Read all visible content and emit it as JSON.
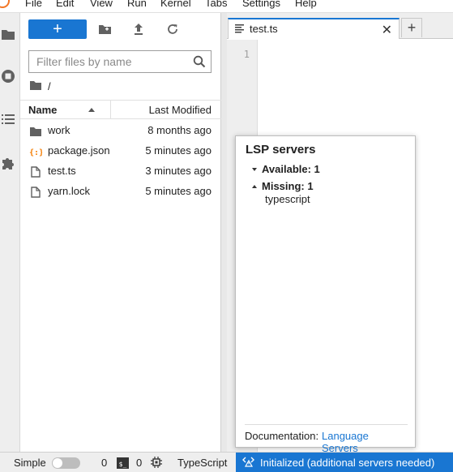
{
  "menubar": {
    "items": [
      "File",
      "Edit",
      "View",
      "Run",
      "Kernel",
      "Tabs",
      "Settings",
      "Help"
    ]
  },
  "filebrowser": {
    "new_label": "+",
    "filter_placeholder": "Filter files by name",
    "breadcrumb": "/",
    "header": {
      "name": "Name",
      "modified": "Last Modified"
    },
    "files": [
      {
        "name": "work",
        "modified": "8 months ago",
        "icon": "folder-icon"
      },
      {
        "name": "package.json",
        "modified": "5 minutes ago",
        "icon": "json-file-icon"
      },
      {
        "name": "test.ts",
        "modified": "3 minutes ago",
        "icon": "file-icon"
      },
      {
        "name": "yarn.lock",
        "modified": "5 minutes ago",
        "icon": "file-icon"
      }
    ]
  },
  "editor": {
    "tab_label": "test.ts",
    "close_glyph": "✕",
    "add_glyph": "+",
    "line_number": "1"
  },
  "lsp_popup": {
    "title": "LSP servers",
    "available_label": "Available: 1",
    "missing_label": "Missing: 1",
    "missing_servers": [
      "typescript"
    ],
    "doc_label": "Documentation:",
    "doc_link": "Language Servers"
  },
  "statusbar": {
    "mode_label": "Simple",
    "simple_mode_on": false,
    "terminals_count": "0",
    "kernels_count": "0",
    "language": "TypeScript",
    "lsp_status": "Initialized (additional servers needed)"
  },
  "colors": {
    "accent": "#1976d2",
    "jupyter_orange": "#f37726",
    "json_icon": "#f57c00"
  }
}
